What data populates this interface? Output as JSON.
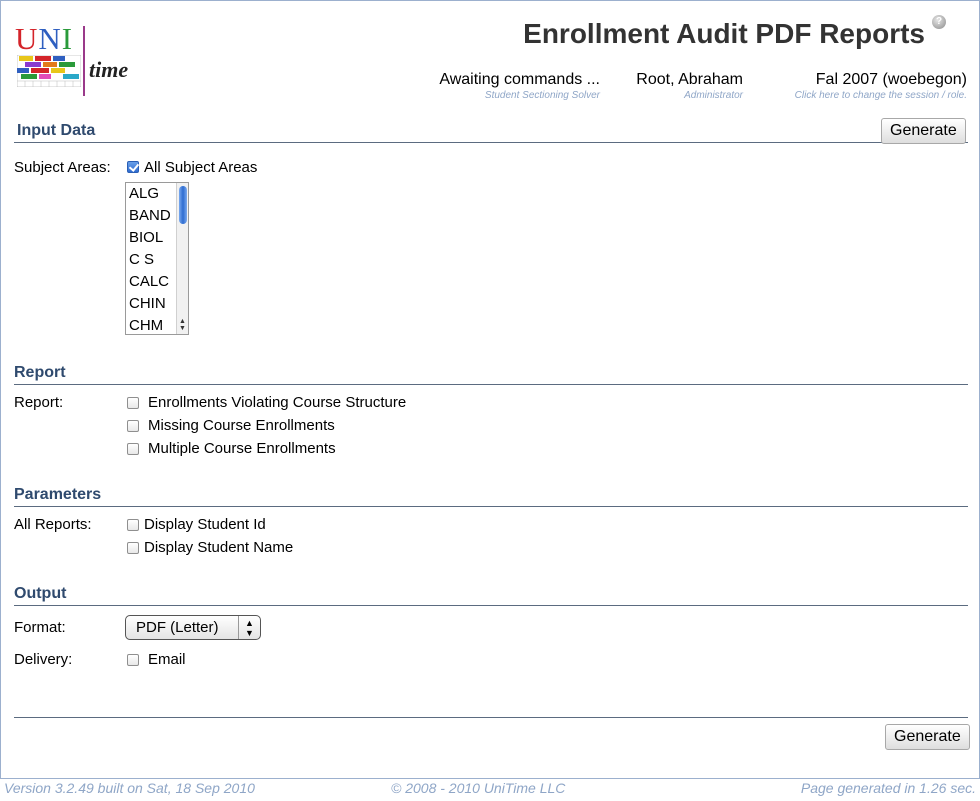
{
  "header": {
    "logo": {
      "u": "U",
      "n": "N",
      "i": "I",
      "time": "time"
    },
    "title": "Enrollment Audit PDF Reports",
    "help_icon_glyph": "?",
    "status": {
      "main": "Awaiting commands ...",
      "sub": "Student Sectioning Solver"
    },
    "user": {
      "main": "Root, Abraham",
      "sub": "Administrator"
    },
    "session": {
      "main": "Fal 2007 (woebegon)",
      "sub": "Click here to change the session / role."
    }
  },
  "input_data": {
    "title": "Input Data",
    "generate_label": "Generate",
    "subject_areas_label": "Subject Areas:",
    "all_subject_areas_label": "All Subject Areas",
    "all_subject_areas_checked": true,
    "subject_list": [
      "ALG",
      "BAND",
      "BIOL",
      "C S",
      "CALC",
      "CHIN",
      "CHM"
    ]
  },
  "report": {
    "title": "Report",
    "label": "Report:",
    "options": [
      {
        "label": "Enrollments Violating Course Structure",
        "checked": false
      },
      {
        "label": "Missing Course Enrollments",
        "checked": false
      },
      {
        "label": "Multiple Course Enrollments",
        "checked": false
      }
    ]
  },
  "parameters": {
    "title": "Parameters",
    "label": "All Reports:",
    "options": [
      {
        "label": "Display Student Id",
        "checked": false
      },
      {
        "label": "Display Student Name",
        "checked": false
      }
    ]
  },
  "output": {
    "title": "Output",
    "format_label": "Format:",
    "format_value": "PDF (Letter)",
    "delivery_label": "Delivery:",
    "email_label": "Email",
    "email_checked": false
  },
  "bottom": {
    "generate_label": "Generate"
  },
  "footer": {
    "version": "Version 3.2.49 built on Sat, 18 Sep 2010",
    "copyright": "© 2008 - 2010 UniTime LLC",
    "generated": "Page generated in 1.26 sec."
  },
  "colors": {
    "section_title": "#2f4a6e",
    "sub_text": "#8fa6c7",
    "border": "#9cb0ce"
  }
}
